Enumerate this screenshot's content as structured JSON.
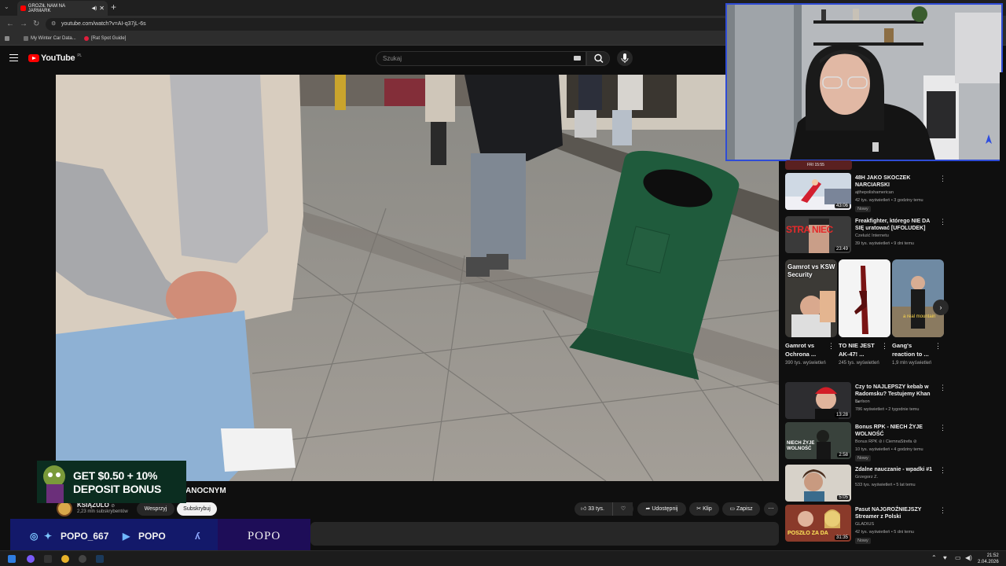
{
  "browser": {
    "tab_title": "GROZIŁ NAM NA JARMARK",
    "url": "youtube.com/watch?v=AI-q37jL-6s",
    "bookmarks": [
      "My Winter Car Data...",
      "[Rat Spot Guide]"
    ]
  },
  "youtube": {
    "logo": "YouTube",
    "region": "PL",
    "search_placeholder": "Szukaj"
  },
  "video": {
    "title_visible_part": "ANOCNYM",
    "channel_name": "KSIĄŻULO",
    "channel_verified": "⊘",
    "subscribers": "2,23 mln subskrybentów",
    "support_label": "Wesprzyj",
    "subscribe_label": "Subskrybuj",
    "likes": "33 tys.",
    "share_label": "Udostępnij",
    "clip_label": "Klip",
    "save_label": "Zapisz"
  },
  "ad": {
    "line1": "GET $0.50 + 10%",
    "line2": "DEPOSIT BONUS"
  },
  "stream_overlay": {
    "handle": "POPO_667",
    "youtube_name": "POPO",
    "brand": "POPO"
  },
  "sidebar": {
    "partial_top_label": "FRI 15:55",
    "videos_top": [
      {
        "title": "48H JAKO SKOCZEK NARCIARSKI",
        "channel": "ajthepolishamerican",
        "meta": "42 tys. wyświetleń • 3 godziny temu",
        "badge": "Nowy",
        "duration": "43:06"
      },
      {
        "title": "Freakfighter, którego NIE DA SIĘ uratować [UFOLUDEK]",
        "channel": "Czeluść Internetu",
        "meta": "39 tys. wyświetleń • 9 dni temu",
        "badge": "",
        "duration": "23:49",
        "thumb_text": "STRA  NIEC"
      }
    ],
    "shorts": [
      {
        "title": "Gamrot vs Ochrona ...",
        "views": "390 tys. wyświetleń",
        "overlay": "Gamrot vs KSW Security"
      },
      {
        "title": "TO NIE JEST AK-47! ...",
        "views": "245 tys. wyświetleń",
        "overlay": ""
      },
      {
        "title": "Gang's reaction to ...",
        "views": "1,9 mln wyświetleń",
        "overlay": "a real mountain"
      }
    ],
    "videos_bottom": [
      {
        "title": "Czy to NAJLEPSZY kebab w Radomsku? Testujemy Khan ...",
        "channel": "Berlson",
        "meta": "786 wyświetleń • 2 tygodnie temu",
        "badge": "",
        "duration": "13:28"
      },
      {
        "title": "Bonus RPK - NIECH ŻYJE WOLNOŚĆ",
        "channel": "Bonus RPK ⊘ i CiemnaStrefa ⊘",
        "meta": "10 tys. wyświetleń • 4 godziny temu",
        "badge": "Nowy",
        "duration": "2:58",
        "thumb_text": "NIECH ŻYJE WOLNOŚĆ"
      },
      {
        "title": "Zdalne nauczanie - wpadki #1",
        "channel": "Grzegorz Z.",
        "meta": "533 tys. wyświetleń • 5 lat temu",
        "badge": "",
        "duration": "5:05"
      },
      {
        "title": "Pasut NAJGROŹNIEJSZY Streamer z Polski",
        "channel": "GLADIUS",
        "meta": "42 tys. wyświetleń • 5 dni temu",
        "badge": "Nowy",
        "duration": "31:35",
        "thumb_text": "POSZŁO ZA DA"
      }
    ]
  },
  "taskbar": {
    "time": "21:52",
    "date": "2.04.2026"
  }
}
